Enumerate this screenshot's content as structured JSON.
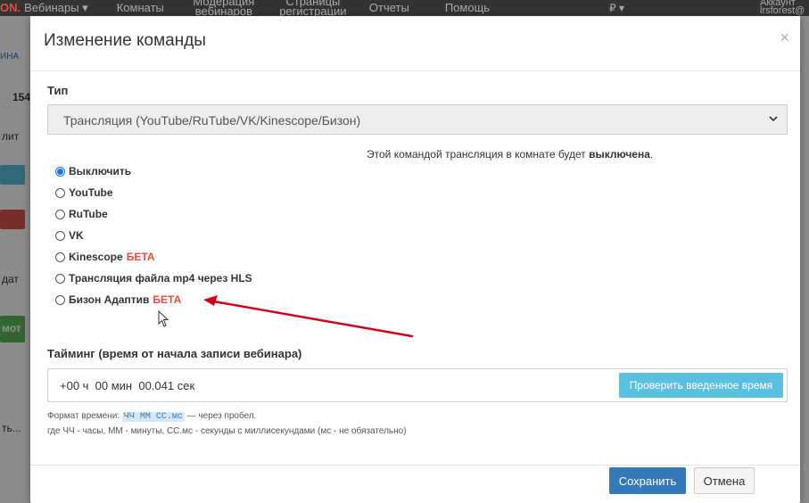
{
  "nav": {
    "brand_prefix": "ON.",
    "items": [
      {
        "label": "Вебинары ▾"
      },
      {
        "label": "Комнаты"
      },
      {
        "label": "Модерация вебинаров"
      },
      {
        "label": "Страницы регистрации"
      },
      {
        "label": "Отчеты"
      },
      {
        "label": "Помощь"
      }
    ],
    "currency": "₽ ▾",
    "account_line1": "Аккаунт",
    "account_line2": "lrsforest@"
  },
  "background_fragments": {
    "f1": "ИНА",
    "f2": "154",
    "f3": "лит",
    "f4": "дат",
    "f5": "мот",
    "f6": "ть...",
    "colors": {
      "btn_blue": "#5bc0de",
      "btn_red": "#d9534f",
      "btn_green": "#5cb85c"
    }
  },
  "modal": {
    "title": "Изменение команды",
    "close_glyph": "×",
    "type_label": "Тип",
    "type_select_value": "Трансляция (YouTube/RuTube/VK/Kinescope/Бизон)",
    "info_text_prefix": "Этой командой трансляция в комнате будет ",
    "info_text_bold": "выключена",
    "info_text_suffix": ".",
    "radio_options": [
      {
        "label": "Выключить",
        "badge": "",
        "checked": true
      },
      {
        "label": "YouTube",
        "badge": "",
        "checked": false
      },
      {
        "label": "RuTube",
        "badge": "",
        "checked": false
      },
      {
        "label": "VK",
        "badge": "",
        "checked": false
      },
      {
        "label": "Kinescope",
        "badge": "БЕТА",
        "checked": false
      },
      {
        "label": "Трансляция файла mp4 через HLS",
        "badge": "",
        "checked": false
      },
      {
        "label": "Бизон Адаптив",
        "badge": "БЕТА",
        "checked": false
      }
    ],
    "timing_label": "Тайминг (время от начала записи вебинара)",
    "timing_value": "+00 ч  00 мин  00.041 сек",
    "check_time_label": "Проверить введенное время",
    "hint_prefix": "Формат времени: ",
    "hint_code": "ЧЧ ММ СС.мс",
    "hint_suffix": " — через пробел.",
    "hint_line2": "где ЧЧ - часы, ММ - минуты, СС.мс - секунды с миллисекундами (мс - не обязательно)",
    "save_label": "Сохранить",
    "cancel_label": "Отмена"
  },
  "colors": {
    "primary": "#337ab7",
    "info": "#5bc0de",
    "beta": "#e74c3c",
    "annotation_arrow": "#d0021b"
  }
}
